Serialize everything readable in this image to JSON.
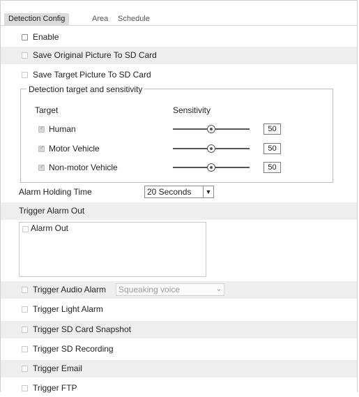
{
  "tabs": [
    {
      "label": "Detection Config",
      "active": true
    },
    {
      "label": "Area",
      "active": false
    },
    {
      "label": "Schedule",
      "active": false
    }
  ],
  "enable": {
    "label": "Enable",
    "checked": false
  },
  "save_original": {
    "label": "Save Original Picture To SD Card",
    "checked": false,
    "disabled": true
  },
  "save_target": {
    "label": "Save Target Picture To SD Card",
    "checked": false,
    "disabled": true
  },
  "detection_group": {
    "legend": "Detection target and sensitivity",
    "col_target": "Target",
    "col_sensitivity": "Sensitivity",
    "targets": [
      {
        "label": "Human",
        "checked": true,
        "sensitivity": "50"
      },
      {
        "label": "Motor Vehicle",
        "checked": true,
        "sensitivity": "50"
      },
      {
        "label": "Non-motor Vehicle",
        "checked": true,
        "sensitivity": "50"
      }
    ]
  },
  "alarm_holding": {
    "label": "Alarm Holding Time",
    "value": "20 Seconds"
  },
  "trigger_alarm_out": {
    "label": "Trigger Alarm Out",
    "items": [
      {
        "label": "Alarm Out",
        "checked": false
      }
    ]
  },
  "trigger_audio": {
    "label": "Trigger Audio Alarm",
    "checked": false,
    "select_value": "Squeaking voice"
  },
  "trigger_light": {
    "label": "Trigger Light Alarm",
    "checked": false
  },
  "trigger_snapshot": {
    "label": "Trigger SD Card Snapshot",
    "checked": false
  },
  "trigger_recording": {
    "label": "Trigger SD Recording",
    "checked": false
  },
  "trigger_email": {
    "label": "Trigger Email",
    "checked": false
  },
  "trigger_ftp": {
    "label": "Trigger FTP",
    "checked": false
  }
}
